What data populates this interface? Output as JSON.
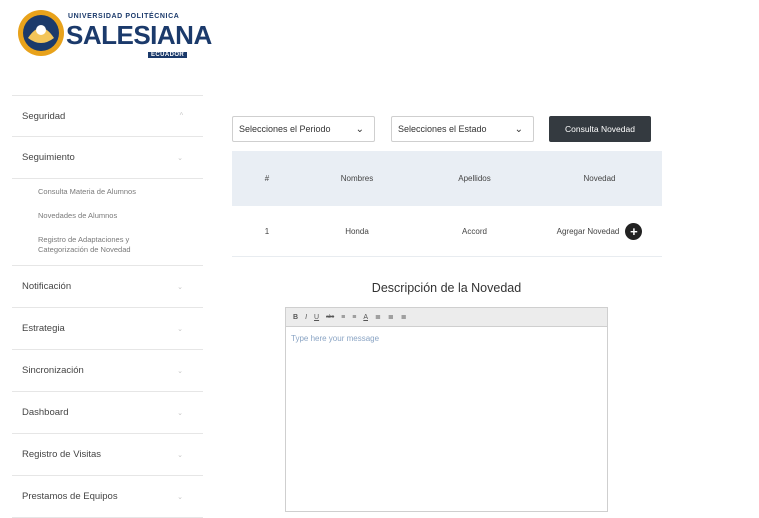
{
  "logo": {
    "university": "UNIVERSIDAD POLITÉCNICA",
    "name": "SALESIANA",
    "country": "ECUADOR"
  },
  "sidebar": {
    "items": [
      {
        "label": "Seguridad"
      },
      {
        "label": "Seguimiento"
      },
      {
        "label": "Notificación"
      },
      {
        "label": "Estrategia"
      },
      {
        "label": "Sincronización"
      },
      {
        "label": "Dashboard"
      },
      {
        "label": "Registro de Visitas"
      },
      {
        "label": "Prestamos de Equipos"
      }
    ],
    "subitems": [
      {
        "label": "Consulta Materia de Alumnos"
      },
      {
        "label": "Novedades de Alumnos"
      },
      {
        "label": "Registro de Adaptaciones y Categorización de Novedad"
      }
    ]
  },
  "filters": {
    "periodo": "Selecciones el Periodo",
    "estado": "Selecciones el Estado",
    "button": "Consulta Novedad"
  },
  "table": {
    "headers": [
      "#",
      "Nombres",
      "Apellidos",
      "Novedad"
    ],
    "rows": [
      {
        "num": "1",
        "nombres": "Honda",
        "apellidos": "Accord",
        "novedad": "Agregar Novedad"
      }
    ]
  },
  "description": {
    "title": "Descripción de la Novedad",
    "placeholder": "Type here your message",
    "toolbar": [
      "B",
      "I",
      "U",
      "abc",
      "≡",
      "≡",
      "A",
      "≣",
      "≣",
      "≣"
    ]
  },
  "icons": {
    "plus": "+",
    "chevron_up": "^",
    "chevron_down": "⌄",
    "dropdown": "⌄"
  },
  "colors": {
    "brand_blue": "#1b3a6b",
    "button_dark": "#343a40",
    "table_header": "#e9eef4"
  }
}
